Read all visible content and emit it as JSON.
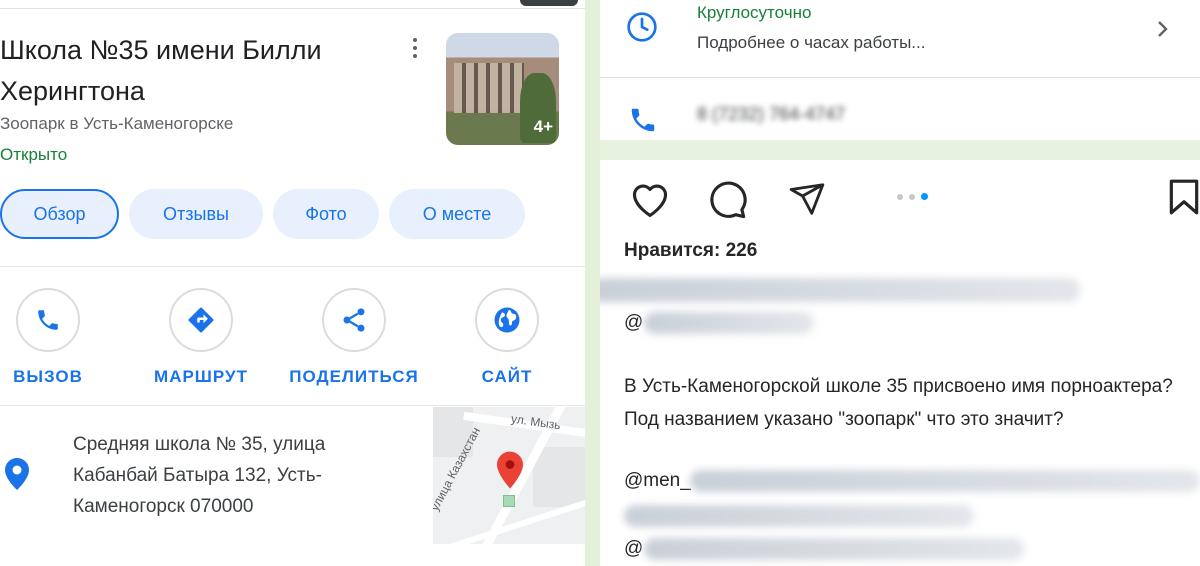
{
  "place": {
    "title": "Школа №35 имени Билли Херингтона",
    "category": "Зоопарк в Усть-Каменогорске",
    "status": "Открыто",
    "photo_count": "4+"
  },
  "tabs": [
    "Обзор",
    "Отзывы",
    "Фото",
    "О месте"
  ],
  "actions": [
    "ВЫЗОВ",
    "МАРШРУТ",
    "ПОДЕЛИТЬСЯ",
    "САЙТ"
  ],
  "address": "Средняя школа № 35, улица Кабанбай Батыра 132, Усть-Каменогорск 070000",
  "map_labels": {
    "street1": "ул. Мызь",
    "street2": "улица Казахстан",
    "street3": "улица Казахстан"
  },
  "hours": {
    "status": "Круглосуточно",
    "more": "Подробнее о часах работы..."
  },
  "phone": "8 (7232) 764-4747",
  "instagram": {
    "likes": "Нравится: 226",
    "at1": "@",
    "caption": "В Усть-Каменогорской  школе 35 присвоено имя порноактера? Под названием указано \"зоопарк\" что это значит?",
    "at2": "@men_",
    "at3": "@"
  },
  "colors": {
    "accent_blue": "#1a73e8",
    "open_green": "#188038",
    "ig_blue": "#0095f6",
    "pin_red": "#ea4335"
  }
}
